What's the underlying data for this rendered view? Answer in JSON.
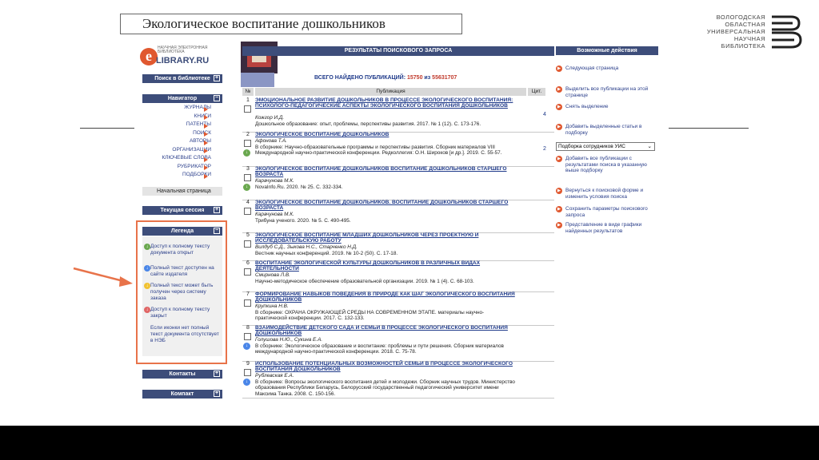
{
  "slide": {
    "title": "Экологическое воспитание дошкольников"
  },
  "library_logo": {
    "lines": [
      "ВОЛОГОДСКАЯ",
      "ОБЛАСТНАЯ",
      "УНИВЕРСАЛЬНАЯ",
      "НАУЧНАЯ",
      "БИБЛИОТЕКА"
    ]
  },
  "elibrary": {
    "logo_tagline": "НАУЧНАЯ ЭЛЕКТРОННАЯ БИБЛИОТЕКА",
    "logo_text": "LIBRARY.RU",
    "logo_letter": "e",
    "search_section": "Поиск в библиотеке",
    "navigator": {
      "title": "Навигатор",
      "items": [
        "ЖУРНАЛЫ",
        "КНИГИ",
        "ПАТЕНТЫ",
        "ПОИСК",
        "АВТОРЫ",
        "ОРГАНИЗАЦИИ",
        "КЛЮЧЕВЫЕ СЛОВА",
        "РУБРИКАТОР",
        "ПОДБОРКИ"
      ],
      "home": "Начальная страница"
    },
    "session": "Текущая сессия",
    "legend": {
      "title": "Легенда",
      "items": [
        {
          "icon": "download-green-icon",
          "color": "#6aa84f",
          "text": "Доступ к полному тексту документа открыт"
        },
        {
          "icon": "download-blue-icon",
          "color": "#4a86e8",
          "text": "Полный текст доступен на сайте издателя"
        },
        {
          "icon": "download-yellow-icon",
          "color": "#f1c232",
          "text": "Полный текст может быть получен через систему заказа"
        },
        {
          "icon": "download-red-icon",
          "color": "#e06666",
          "text": "Доступ к полному тексту закрыт"
        }
      ],
      "note": "Если иконки нет полный текст документа отсутствует в НЭБ"
    },
    "contacts": "Контакты",
    "compact": "Компакт",
    "results": {
      "header": "РЕЗУЛЬТАТЫ ПОИСКОВОГО ЗАПРОСА",
      "found_label": "ВСЕГО НАЙДЕНО ПУБЛИКАЦИЙ:",
      "found": "15750",
      "of_label": "из",
      "total": "55631707",
      "col_num": "№",
      "col_pub": "Публикация",
      "col_cit": "Цит.",
      "rows": [
        {
          "n": "1",
          "title": "ЭМОЦИОНАЛЬНОЕ РАЗВИТИЕ ДОШКОЛЬНИКОВ В ПРОЦЕССЕ ЭКОЛОГИЧЕСКОГО ВОСПИТАНИЯ: ПСИХОЛОГО-ПЕДАГОГИЧЕСКИЕ АСПЕКТЫ ЭКОЛОГИЧЕСКОГО ВОСПИТАНИЯ ДОШКОЛЬНИКОВ",
          "authors": "Кожгор И.Д.",
          "source": "Дошкольное образование: опыт, проблемы, перспективы развития. 2017. № 1 (12). С. 173-176.",
          "cit": "4",
          "icon": ""
        },
        {
          "n": "2",
          "title": "ЭКОЛОГИЧЕСКОЕ ВОСПИТАНИЕ ДОШКОЛЬНИКОВ",
          "authors": "Афонова Т.А.",
          "source": "В сборнике: Научно-образовательные программы и перспективы развития. Сборник материалов VIII Международной научно-практической конференции. Редколлегия: О.Н. Широков [и др.]. 2019. С. 55-57.",
          "cit": "2",
          "icon": "#6aa84f"
        },
        {
          "n": "3",
          "title": "ЭКОЛОГИЧЕСКОЕ ВОСПИТАНИЕ ДОШКОЛЬНИКОВ ВОСПИТАНИЕ ДОШКОЛЬНИКОВ СТАРШЕГО ВОЗРАСТА",
          "authors": "Карачунова М.К.",
          "source": "NovaInfo.Ru. 2020. № 25. С. 332-334.",
          "cit": "",
          "icon": "#6aa84f"
        },
        {
          "n": "4",
          "title": "ЭКОЛОГИЧЕСКОЕ ВОСПИТАНИЕ ДОШКОЛЬНИКОВ. ВОСПИТАНИЕ ДОШКОЛЬНИКОВ СТАРШЕГО ВОЗРАСТА",
          "authors": "Карачунова М.К.",
          "source": "Трибуна ученого. 2020. № 5. С. 490-495.",
          "cit": "",
          "icon": ""
        },
        {
          "n": "5",
          "title": "ЭКОЛОГИЧЕСКОЕ ВОСПИТАНИЕ МЛАДШИХ ДОШКОЛЬНИКОВ ЧЕРЕЗ ПРОЕКТНУЮ И ИССЛЕДОВАТЕЛЬСКУЮ РАБОТУ",
          "authors": "Вилдуб С.Д., Зыкова Н.С., Старченко Н.Д.",
          "source": "Вестник научных конференций. 2019. № 10-2 (50). С. 17-18.",
          "cit": "",
          "icon": ""
        },
        {
          "n": "6",
          "title": "ВОСПИТАНИЕ ЭКОЛОГИЧЕСКОЙ КУЛЬТУРЫ ДОШКОЛЬНИКОВ В РАЗЛИЧНЫХ ВИДАХ ДЕЯТЕЛЬНОСТИ",
          "authors": "Смирнова Л.В.",
          "source": "Научно-методическое обеспечение образовательной организации. 2019. № 1 (4). С. 68-103.",
          "cit": "",
          "icon": ""
        },
        {
          "n": "7",
          "title": "ФОРМИРОВАНИЕ НАВЫКОВ ПОВЕДЕНИЯ В ПРИРОДЕ КАК ШАГ ЭКОЛОГИЧЕСКОГО ВОСПИТАНИЯ ДОШКОЛЬНИКОВ",
          "authors": "Крупкина Н.В.",
          "source": "В сборнике: ОХРАНА ОКРУЖАЮЩЕЙ СРЕДЫ НА СОВРЕМЕННОМ ЭТАПЕ. материалы научно-практической конференции. 2017. С. 132-133.",
          "cit": "",
          "icon": ""
        },
        {
          "n": "8",
          "title": "ВЗАИМОДЕЙСТВИЕ ДЕТСКОГО САДА И СЕМЬИ В ПРОЦЕССЕ ЭКОЛОГИЧЕСКОГО ВОСПИТАНИЯ ДОШКОЛЬНИКОВ",
          "authors": "Голушова Н.Ю., Сукина Е.А.",
          "source": "В сборнике: Экологическое образование и воспитание: проблемы и пути решения. Сборник материалов международной научно-практической конференции. 2018. С. 75-78.",
          "cit": "",
          "icon": "#4a86e8"
        },
        {
          "n": "9",
          "title": "ИСПОЛЬЗОВАНИЕ ПОТЕНЦИАЛЬНЫХ ВОЗМОЖНОСТЕЙ СЕМЬИ В ПРОЦЕССЕ ЭКОЛОГИЧЕСКОГО ВОСПИТАНИЯ ДОШКОЛЬНИКОВ",
          "authors": "Рублевская Е.А.",
          "source": "В сборнике: Вопросы экологического воспитания детей и молодежи. Сборник научных трудов. Министерство образования Республики Беларусь, Белорусский государственный педагогический университет имени Максима Танка. 2008. С. 150-156.",
          "cit": "",
          "icon": "#4a86e8"
        }
      ]
    },
    "actions": {
      "title": "Возможные действия",
      "items": [
        "Следующая страница",
        "Выделить все публикации на этой странице",
        "Снять выделение",
        "Добавить выделенные статьи в подборку",
        "Добавить все публикации с результатами поиска в указанную выше подборку",
        "Вернуться к поисковой форме и изменить условия поиска",
        "Сохранить параметры поискового запроса",
        "Представление в виде графики найденных результатов"
      ],
      "select_value": "Подборка сотрудников УИС"
    }
  }
}
